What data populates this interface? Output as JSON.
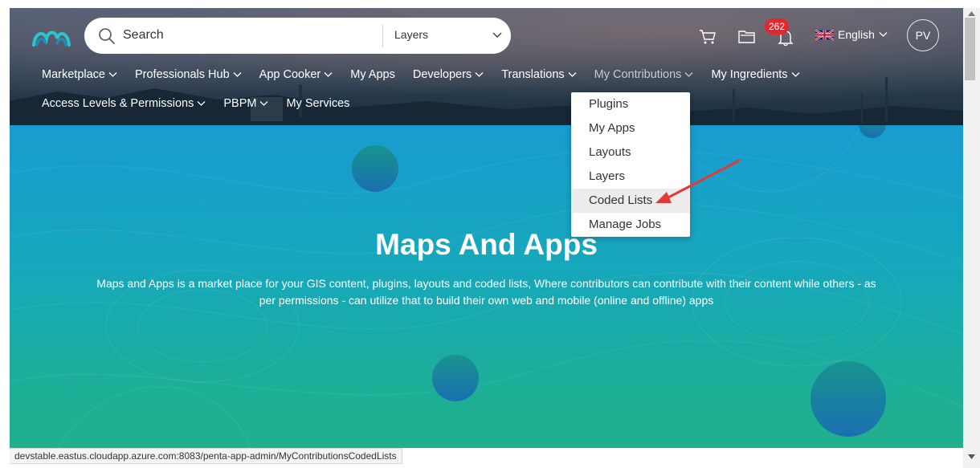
{
  "search": {
    "placeholder": "Search",
    "scope_selected": "Layers"
  },
  "notifications": {
    "count": "262"
  },
  "language": {
    "label": "English"
  },
  "user": {
    "initials": "PV"
  },
  "nav": {
    "row1": [
      {
        "label": "Marketplace",
        "has_menu": true
      },
      {
        "label": "Professionals Hub",
        "has_menu": true
      },
      {
        "label": "App Cooker",
        "has_menu": true
      },
      {
        "label": "My Apps",
        "has_menu": false
      },
      {
        "label": "Developers",
        "has_menu": true
      },
      {
        "label": "Translations",
        "has_menu": true
      },
      {
        "label": "My Contributions",
        "has_menu": true,
        "active": true
      },
      {
        "label": "My Ingredients",
        "has_menu": true
      }
    ],
    "row2": [
      {
        "label": "Access Levels & Permissions",
        "has_menu": true
      },
      {
        "label": "PBPM",
        "has_menu": true
      },
      {
        "label": "My Services",
        "has_menu": false
      }
    ]
  },
  "contributions_menu": {
    "items": [
      "Plugins",
      "My Apps",
      "Layouts",
      "Layers",
      "Coded Lists",
      "Manage Jobs"
    ],
    "highlighted": "Coded Lists"
  },
  "hero": {
    "title": "Maps And Apps",
    "description": "Maps and Apps is a market place for your GIS content, plugins, layouts and coded lists, Where contributors can contribute with their content while others - as per permissions - can utilize that to build their own web and mobile (online and offline) apps"
  },
  "status_url": "devstable.eastus.cloudapp.azure.com:8083/penta-app-admin/MyContributionsCodedLists",
  "colors": {
    "hero_top": "#199bd0",
    "hero_bottom": "#21b08d",
    "badge": "#e5262e",
    "annotation_arrow": "#e03a3a"
  },
  "icons": [
    "logo-icon",
    "search-icon",
    "chevron-down-icon",
    "cart-icon",
    "folder-icon",
    "bell-icon",
    "uk-flag-icon"
  ]
}
